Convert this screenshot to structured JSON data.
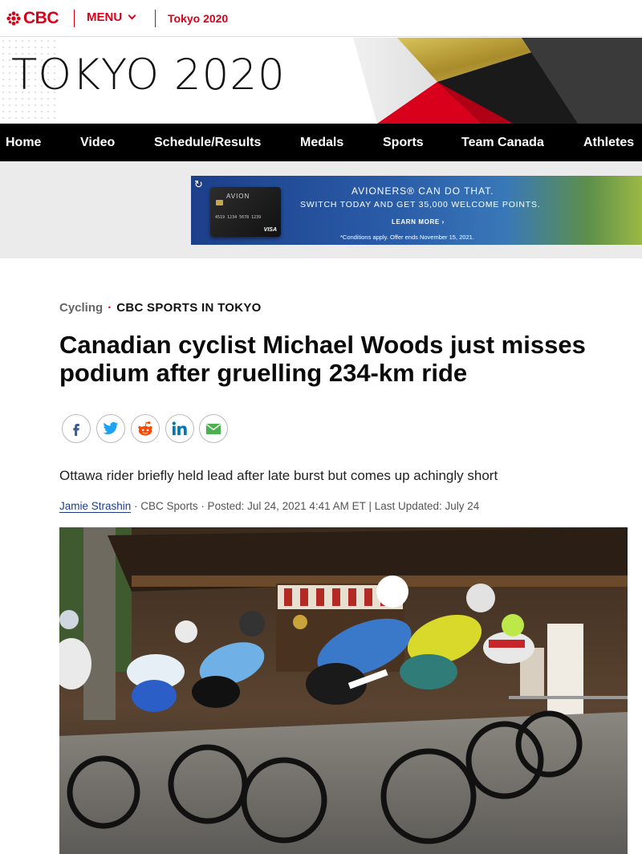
{
  "topbar": {
    "logo_text": "CBC",
    "menu_label": "MENU",
    "section_label": "Tokyo 2020"
  },
  "hero": {
    "title": "TOKYO 2020"
  },
  "nav": {
    "items": [
      "Home",
      "Video",
      "Schedule/Results",
      "Medals",
      "Sports",
      "Team Canada",
      "Athletes"
    ]
  },
  "ad": {
    "card_name": "AVION",
    "card_number": "4519 1234 5678 1239",
    "card_network": "VISA",
    "line1": "AVIONERS® CAN DO THAT.",
    "line2": "SWITCH TODAY AND GET 35,000 WELCOME POINTS.",
    "cta": "LEARN MORE ›",
    "disclaimer": "*Conditions apply. Offer ends November 15, 2021."
  },
  "article": {
    "category": "Cycling",
    "show": "CBC SPORTS IN TOKYO",
    "headline": "Canadian cyclist Michael Woods just misses podium after gruelling 234-km ride",
    "deck": "Ottawa rider briefly held lead after late burst but comes up achingly short",
    "author": "Jamie Strashin",
    "byline_rest": " · CBC Sports · Posted: Jul 24, 2021 4:41 AM ET | Last Updated: July 24"
  },
  "share": {
    "icons": [
      "facebook-icon",
      "twitter-icon",
      "reddit-icon",
      "linkedin-icon",
      "email-icon"
    ]
  },
  "colors": {
    "brand_red": "#d8001a",
    "nav_bg": "#000000",
    "facebook": "#3b5998",
    "twitter": "#1da1f2",
    "reddit": "#ff4500",
    "linkedin": "#0077b5",
    "email": "#4caf50"
  }
}
